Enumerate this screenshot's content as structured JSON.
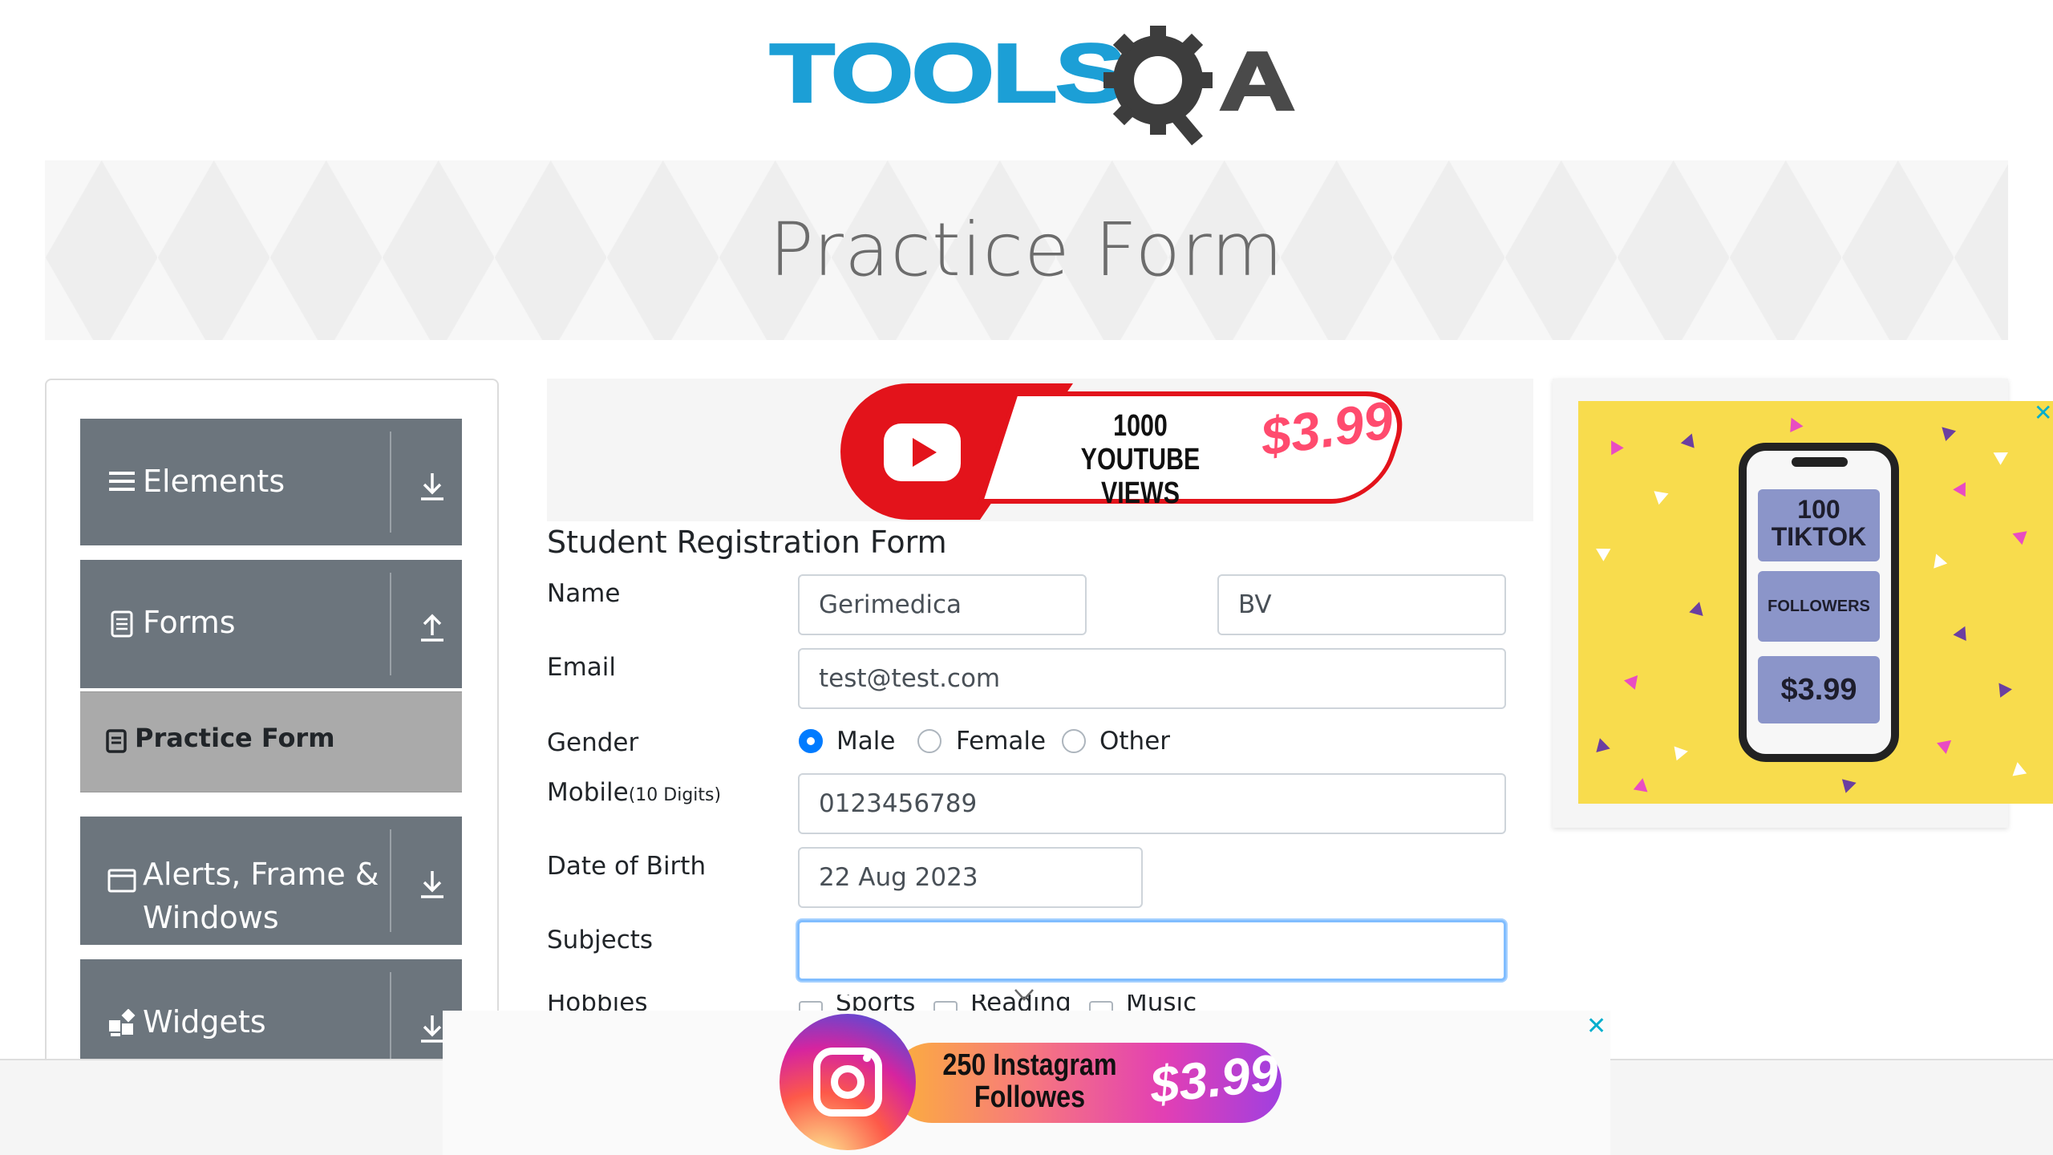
{
  "logo": {
    "brand_left": "TOOLS",
    "brand_right": "A"
  },
  "banner": {
    "title": "Practice Form"
  },
  "sidebar": {
    "groups": [
      {
        "label": "Elements",
        "icon": "menu-icon",
        "arrow": "download-arrow-icon"
      },
      {
        "label": "Forms",
        "icon": "document-icon",
        "arrow": "upload-arrow-icon"
      },
      {
        "label_line1": "Alerts, Frame &",
        "label_line2": "Windows",
        "icon": "window-icon",
        "arrow": "download-arrow-icon"
      },
      {
        "label": "Widgets",
        "icon": "widgets-icon",
        "arrow": "download-arrow-icon"
      }
    ],
    "active_item": {
      "label": "Practice Form",
      "icon": "form-icon"
    }
  },
  "ads": {
    "youtube": {
      "line1": "1000",
      "line2": "YOUTUBE VIEWS",
      "price": "$3.99"
    },
    "tiktok": {
      "count": "100",
      "platform": "TIKTOK",
      "unit": "FOLLOWERS",
      "price": "$3.99"
    },
    "instagram": {
      "line1": "250 Instagram",
      "line2": "Followes",
      "price": "$3.99"
    }
  },
  "form": {
    "title": "Student Registration Form",
    "name_label": "Name",
    "first_name_value": "Gerimedica",
    "last_name_value": "BV",
    "email_label": "Email",
    "email_value": "test@test.com",
    "gender_label": "Gender",
    "gender_options": [
      "Male",
      "Female",
      "Other"
    ],
    "gender_selected": "Male",
    "mobile_label": "Mobile",
    "mobile_hint": "(10 Digits)",
    "mobile_value": "0123456789",
    "dob_label": "Date of Birth",
    "dob_value": "22 Aug 2023",
    "subjects_label": "Subjects",
    "subjects_value": "",
    "hobbies_label": "Hobbies",
    "hobbies_options": [
      "Sports",
      "Reading",
      "Music"
    ]
  },
  "colors": {
    "brand_blue": "#1c9fd6",
    "sidebar_group": "#6c757d",
    "sidebar_active": "#aaaaaa",
    "radio_checked": "#007bff",
    "focus_border": "#80bdff",
    "ad_close": "#00aecd"
  }
}
